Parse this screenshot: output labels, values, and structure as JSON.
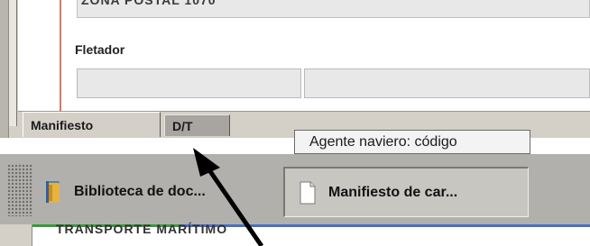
{
  "form": {
    "postal_field_value": "ZONA POSTAL 1070",
    "fletador_label": "Fletador",
    "fletador_field1_value": "",
    "fletador_field2_value": ""
  },
  "tabs": [
    {
      "label": "Manifiesto",
      "selected": true
    },
    {
      "label": "D/T",
      "selected": false
    }
  ],
  "tooltip": {
    "text": "Agente naviero: código"
  },
  "taskbar": {
    "items": [
      {
        "label": "Biblioteca de doc...",
        "icon": "library-book-icon",
        "active": false
      },
      {
        "label": "Manifiesto de car...",
        "icon": "document-icon",
        "active": true
      }
    ]
  },
  "background_window": {
    "title_text": "TRANSPORTE MARÍTIMO"
  },
  "annotation": {
    "icon": "pointer-arrow-icon"
  },
  "colors": {
    "window_face": "#d4d0c8",
    "taskbar": "#b2b0ac",
    "field_fill": "#e8e8e8",
    "active_tab_accent": "#a8a5a0"
  }
}
